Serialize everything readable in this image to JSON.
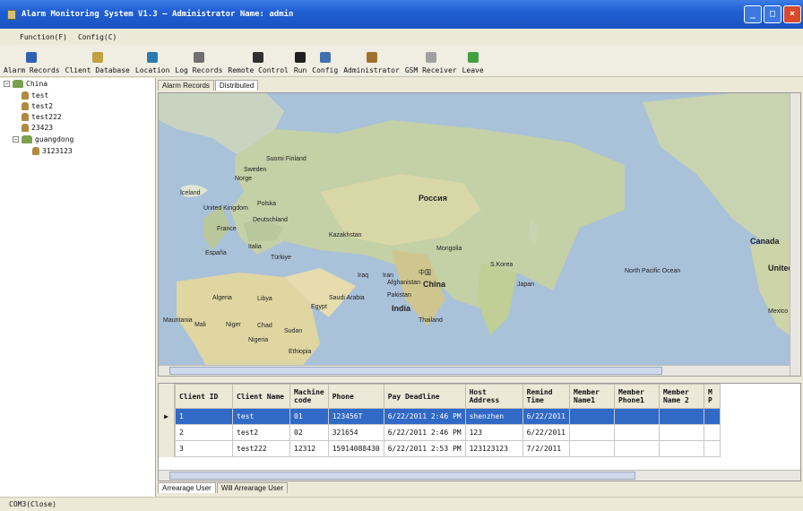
{
  "window": {
    "title": "Alarm Monitoring System V1.3 — Administrator Name: admin"
  },
  "menu": [
    "Function(F)",
    "Config(C)"
  ],
  "toolbar": [
    {
      "label": "Alarm Records",
      "icon": "alarm-records-icon",
      "color": "#3060b0"
    },
    {
      "label": "Client Database",
      "icon": "client-database-icon",
      "color": "#c0a040"
    },
    {
      "label": "Location",
      "icon": "location-icon",
      "color": "#2a7ab0"
    },
    {
      "label": "Log Records",
      "icon": "log-records-icon",
      "color": "#707070"
    },
    {
      "label": "Remote Control",
      "icon": "remote-control-icon",
      "color": "#303030"
    },
    {
      "label": "Run",
      "icon": "run-icon",
      "color": "#202020"
    },
    {
      "label": "Config",
      "icon": "config-icon",
      "color": "#4070b0"
    },
    {
      "label": "Administrator",
      "icon": "administrator-icon",
      "color": "#a07030"
    },
    {
      "label": "GSM Receiver",
      "icon": "gsm-receiver-icon",
      "color": "#a0a0a0"
    },
    {
      "label": "Leave",
      "icon": "leave-icon",
      "color": "#40a040"
    }
  ],
  "tree": {
    "root": "China",
    "children": [
      "test",
      "test2",
      "test222",
      "23423"
    ],
    "group": "guangdong",
    "group_children": [
      "3123123"
    ]
  },
  "map_tabs": [
    "Alarm Records",
    "Distributed"
  ],
  "map_labels": [
    "Iceland",
    "Sweden",
    "Suomi Finland",
    "Norge",
    "United Kingdom",
    "Polska",
    "Deutschland",
    "France",
    "España",
    "Italia",
    "Türkiye",
    "Россия",
    "Kazakhstan",
    "Mongolia",
    "中国",
    "China",
    "India",
    "Japan",
    "S.Korea",
    "Thailand",
    "Algeria",
    "Libya",
    "Egypt",
    "Saudi Arabia",
    "Iraq",
    "Iran",
    "Afghanistan",
    "Pakistan",
    "Mauritania",
    "Mali",
    "Niger",
    "Chad",
    "Sudan",
    "Nigeria",
    "Ethiopia",
    "Canada",
    "United States",
    "North Pacific Ocean",
    "Mexico"
  ],
  "table": {
    "columns": [
      "Client ID",
      "Client Name",
      "Machine code",
      "Phone",
      "Pay Deadline",
      "Host Address",
      "Remind Time",
      "Member Name1",
      "Member Phone1",
      "Member Name 2",
      "M P"
    ],
    "rows": [
      [
        "1",
        "test",
        "01",
        "123456T",
        "6/22/2011 2:46 PM",
        "shenzhen",
        "6/22/2011",
        "",
        "",
        "",
        ""
      ],
      [
        "2",
        "test2",
        "02",
        "321654",
        "6/22/2011 2:46 PM",
        "123",
        "6/22/2011",
        "",
        "",
        "",
        ""
      ],
      [
        "3",
        "test222",
        "12312",
        "15914088430",
        "6/22/2011 2:53 PM",
        "123123123",
        "7/2/2011",
        "",
        "",
        "",
        ""
      ]
    ],
    "selected_row": 0
  },
  "bottom_tabs": [
    "Arrearage User",
    "Will Arrearage User"
  ],
  "status": "COM3(Close)"
}
